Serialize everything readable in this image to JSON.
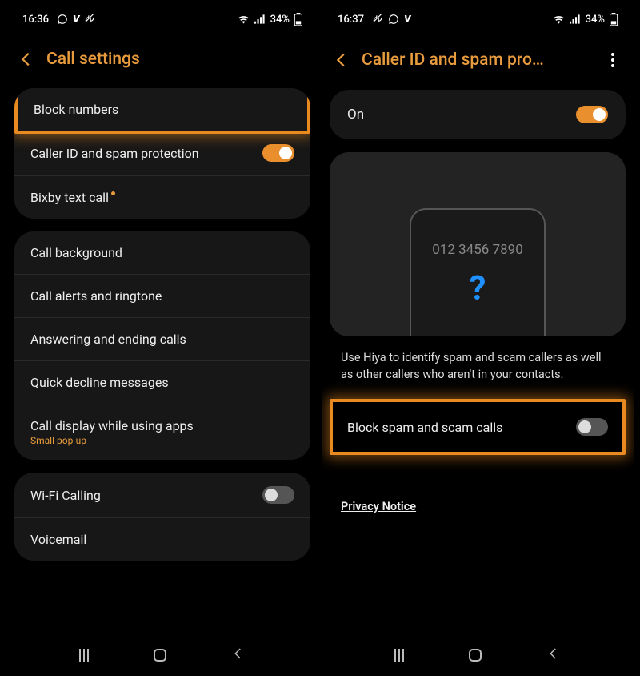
{
  "left": {
    "status": {
      "time": "16:36",
      "battery": "34%"
    },
    "header": {
      "title": "Call settings"
    },
    "group1": [
      {
        "label": "Block numbers",
        "highlight": true
      },
      {
        "label": "Caller ID and spam protection",
        "toggle": "on"
      },
      {
        "label": "Bixby text call",
        "dot": true
      }
    ],
    "group2": [
      {
        "label": "Call background"
      },
      {
        "label": "Call alerts and ringtone"
      },
      {
        "label": "Answering and ending calls"
      },
      {
        "label": "Quick decline messages"
      },
      {
        "label": "Call display while using apps",
        "sub": "Small pop-up"
      }
    ],
    "group3": [
      {
        "label": "Wi-Fi Calling",
        "toggle": "off"
      },
      {
        "label": "Voicemail"
      }
    ]
  },
  "right": {
    "status": {
      "time": "16:37",
      "battery": "34%"
    },
    "header": {
      "title": "Caller ID and spam pro…"
    },
    "main_toggle": {
      "label": "On",
      "state": "on"
    },
    "preview": {
      "number": "012 3456 7890",
      "mark": "?"
    },
    "description": "Use Hiya to identify spam and scam callers as well as other callers who aren't in your contacts.",
    "block_row": {
      "label": "Block spam and scam calls",
      "state": "off"
    },
    "privacy": "Privacy Notice"
  }
}
